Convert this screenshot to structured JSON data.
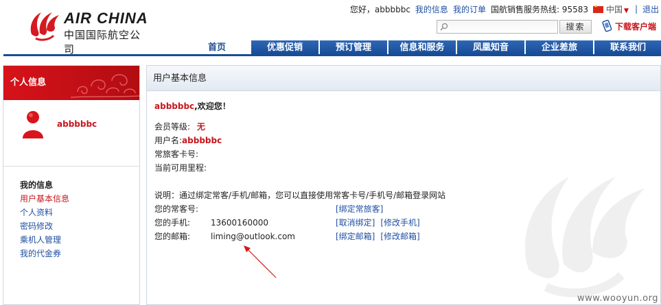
{
  "brand": {
    "name_en": "AIR CHINA",
    "name_cn": "中国国际航空公司"
  },
  "top_bar": {
    "greeting": "您好，abbbbbc",
    "my_info": "我的信息",
    "my_orders": "我的订单",
    "hotline": "国航销售服务热线: 95583",
    "region": "中国",
    "logout": "退出"
  },
  "search": {
    "placeholder": "",
    "button": "搜索"
  },
  "download_label": "下载客户端",
  "nav": {
    "items": [
      "首页",
      "优惠促销",
      "预订管理",
      "信息和服务",
      "凤凰知音",
      "企业差旅",
      "联系我们"
    ]
  },
  "sidebar": {
    "header": "个人信息",
    "username": "abbbbbc",
    "menu_title": "我的信息",
    "menu": [
      "用户基本信息",
      "个人资料",
      "密码修改",
      "乘机人管理",
      "我的代金券"
    ]
  },
  "main": {
    "title": "用户基本信息",
    "welcome_name": "abbbbbc",
    "welcome_suffix": ",欢迎您！",
    "member_level_label": "会员等级:",
    "member_level_value": "无",
    "username_label": "用户名:",
    "username_value": "abbbbbc",
    "card_label": "常旅客卡号:",
    "mileage_label": "当前可用里程:",
    "note": "说明：通过绑定常客/手机/邮箱，您可以直接使用常客卡号/手机号/邮箱登录网站",
    "ff_label": "您的常客号:",
    "ff_action": "[绑定常旅客]",
    "phone_label": "您的手机:",
    "phone_value": "13600160000",
    "phone_action1": "[取消绑定]",
    "phone_action2": "[修改手机]",
    "email_label": "您的邮箱:",
    "email_value": "liming@outlook.com",
    "email_action1": "[绑定邮箱]",
    "email_action2": "[修改邮箱]"
  },
  "watermark": "www.wooyun.org",
  "colors": {
    "brand_red": "#c8161d",
    "nav_blue": "#1b4c94",
    "link_blue": "#1f4fa3"
  }
}
